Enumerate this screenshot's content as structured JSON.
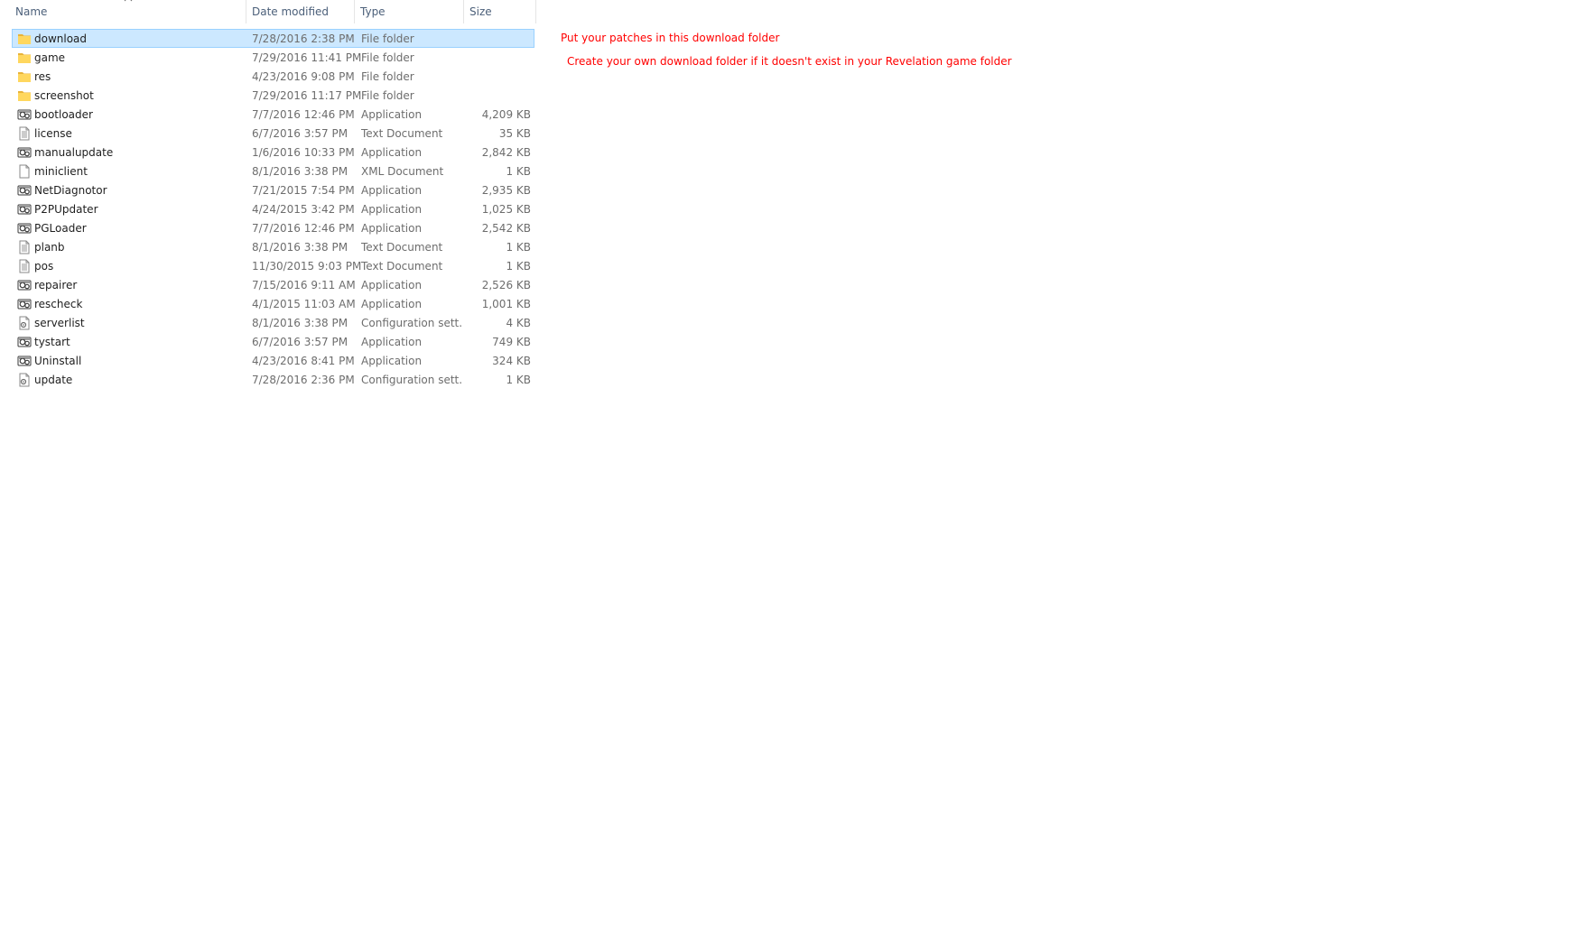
{
  "columns": {
    "name": "Name",
    "date_modified": "Date modified",
    "type": "Type",
    "size": "Size",
    "sort_column": "name",
    "sort_direction": "ascending"
  },
  "files": [
    {
      "name": "download",
      "date": "7/28/2016 2:38 PM",
      "type": "File folder",
      "size": "",
      "icon": "folder-icon",
      "selected": true
    },
    {
      "name": "game",
      "date": "7/29/2016 11:41 PM",
      "type": "File folder",
      "size": "",
      "icon": "folder-icon",
      "selected": false
    },
    {
      "name": "res",
      "date": "4/23/2016 9:08 PM",
      "type": "File folder",
      "size": "",
      "icon": "folder-icon",
      "selected": false
    },
    {
      "name": "screenshot",
      "date": "7/29/2016 11:17 PM",
      "type": "File folder",
      "size": "",
      "icon": "folder-icon",
      "selected": false
    },
    {
      "name": "bootloader",
      "date": "7/7/2016 12:46 PM",
      "type": "Application",
      "size": "4,209 KB",
      "icon": "application-icon",
      "selected": false
    },
    {
      "name": "license",
      "date": "6/7/2016 3:57 PM",
      "type": "Text Document",
      "size": "35 KB",
      "icon": "text-document-icon",
      "selected": false
    },
    {
      "name": "manualupdate",
      "date": "1/6/2016 10:33 PM",
      "type": "Application",
      "size": "2,842 KB",
      "icon": "application-icon",
      "selected": false
    },
    {
      "name": "miniclient",
      "date": "8/1/2016 3:38 PM",
      "type": "XML Document",
      "size": "1 KB",
      "icon": "xml-document-icon",
      "selected": false
    },
    {
      "name": "NetDiagnotor",
      "date": "7/21/2015 7:54 PM",
      "type": "Application",
      "size": "2,935 KB",
      "icon": "application-icon",
      "selected": false
    },
    {
      "name": "P2PUpdater",
      "date": "4/24/2015 3:42 PM",
      "type": "Application",
      "size": "1,025 KB",
      "icon": "application-icon",
      "selected": false
    },
    {
      "name": "PGLoader",
      "date": "7/7/2016 12:46 PM",
      "type": "Application",
      "size": "2,542 KB",
      "icon": "application-icon",
      "selected": false
    },
    {
      "name": "planb",
      "date": "8/1/2016 3:38 PM",
      "type": "Text Document",
      "size": "1 KB",
      "icon": "text-document-icon",
      "selected": false
    },
    {
      "name": "pos",
      "date": "11/30/2015 9:03 PM",
      "type": "Text Document",
      "size": "1 KB",
      "icon": "text-document-icon",
      "selected": false
    },
    {
      "name": "repairer",
      "date": "7/15/2016 9:11 AM",
      "type": "Application",
      "size": "2,526 KB",
      "icon": "application-icon",
      "selected": false
    },
    {
      "name": "rescheck",
      "date": "4/1/2015 11:03 AM",
      "type": "Application",
      "size": "1,001 KB",
      "icon": "application-icon",
      "selected": false
    },
    {
      "name": "serverlist",
      "date": "8/1/2016 3:38 PM",
      "type": "Configuration sett...",
      "size": "4 KB",
      "icon": "config-settings-icon",
      "selected": false
    },
    {
      "name": "tystart",
      "date": "6/7/2016 3:57 PM",
      "type": "Application",
      "size": "749 KB",
      "icon": "application-icon",
      "selected": false
    },
    {
      "name": "Uninstall",
      "date": "4/23/2016 8:41 PM",
      "type": "Application",
      "size": "324 KB",
      "icon": "application-icon",
      "selected": false
    },
    {
      "name": "update",
      "date": "7/28/2016 2:36 PM",
      "type": "Configuration sett...",
      "size": "1 KB",
      "icon": "config-settings-icon",
      "selected": false
    }
  ],
  "annotations": {
    "line1": "Put your patches in this download folder",
    "line2": "Create your own download folder if it doesn't exist in your Revelation game folder",
    "color": "#ff0000"
  },
  "colors": {
    "selection_bg": "#cce8ff",
    "selection_border": "#99d1ff",
    "header_text": "#4c607a",
    "folder": "#ffd75e"
  }
}
